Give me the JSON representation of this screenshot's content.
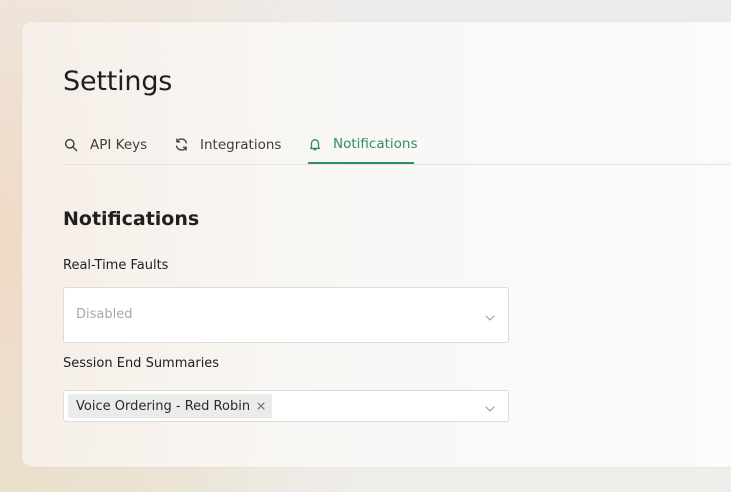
{
  "page": {
    "title": "Settings"
  },
  "tabs": [
    {
      "label": "API Keys",
      "icon": "search-icon",
      "active": false
    },
    {
      "label": "Integrations",
      "icon": "refresh-icon",
      "active": false
    },
    {
      "label": "Notifications",
      "icon": "bell-icon",
      "active": true
    }
  ],
  "notifications": {
    "section_title": "Notifications",
    "real_time_faults": {
      "label": "Real-Time Faults",
      "placeholder": "Disabled",
      "value": ""
    },
    "session_end_summaries": {
      "label": "Session End Summaries",
      "selected": [
        "Voice Ordering - Red Robin"
      ]
    }
  },
  "colors": {
    "accent": "#2f8f67",
    "text": "#1f1f1f",
    "border": "#dcdcda",
    "chip_bg": "#ebebea"
  }
}
